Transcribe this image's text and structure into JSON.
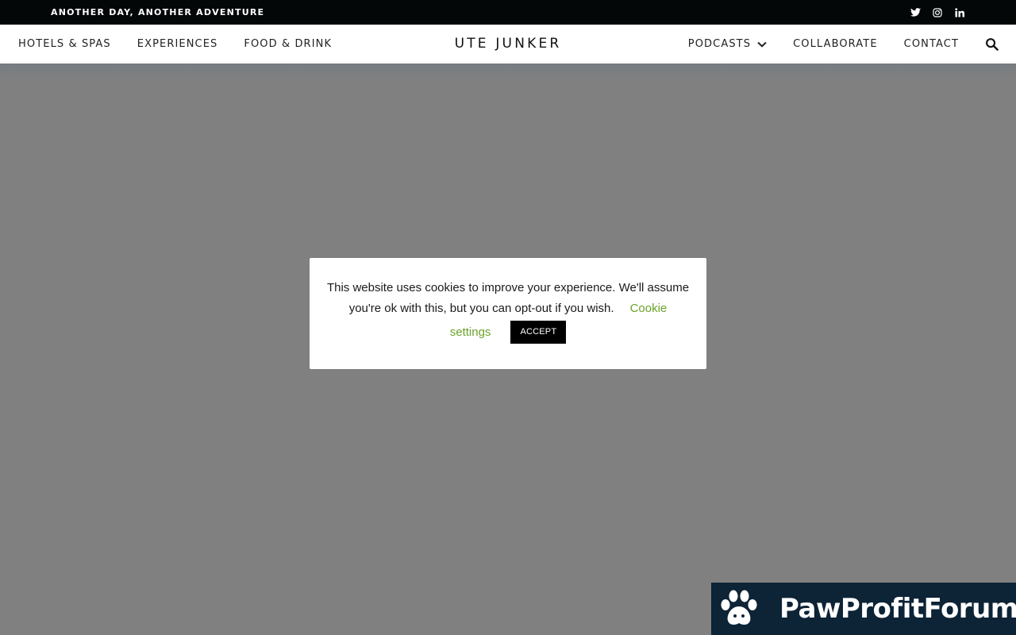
{
  "topbar": {
    "tagline": "ANOTHER DAY, ANOTHER ADVENTURE",
    "social": [
      "twitter-icon",
      "instagram-icon",
      "linkedin-icon"
    ]
  },
  "header": {
    "site_title": "UTE JUNKER",
    "nav_left": [
      {
        "label": "HOTELS & SPAS"
      },
      {
        "label": "EXPERIENCES"
      },
      {
        "label": "FOOD & DRINK"
      }
    ],
    "nav_right": [
      {
        "label": "PODCASTS",
        "icon": "chevron-down-icon"
      },
      {
        "label": "COLLABORATE"
      },
      {
        "label": "CONTACT"
      }
    ],
    "search_icon": "search-icon"
  },
  "cookie_banner": {
    "message": "This website uses cookies to improve your experience. We'll assume you're ok with this, but you can opt-out if you wish.",
    "line1": "This website uses cookies to improve your experience. We'll assume",
    "line2": "you're ok with this, but you can opt-out if you wish.",
    "settings_link_part1": "Cookie",
    "settings_link_part2": "settings",
    "accept_label": "ACCEPT"
  },
  "watermark": {
    "text": "PawProfitForum"
  },
  "colors": {
    "topbar_bg": "#030708",
    "overlay": "#808080",
    "link_green": "#6aa32a",
    "watermark_bg": "#0d2336"
  }
}
